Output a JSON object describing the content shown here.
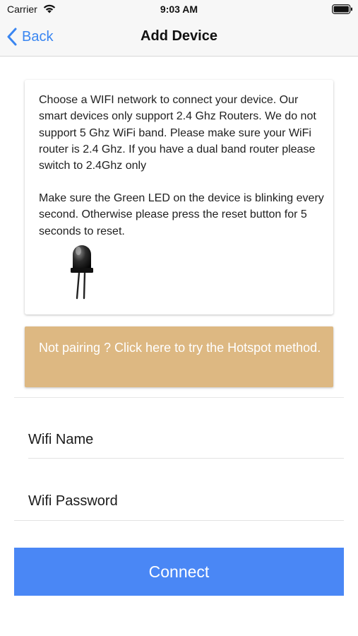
{
  "status_bar": {
    "carrier": "Carrier",
    "time": "9:03 AM",
    "wifi_icon": "wifi-icon",
    "battery_icon": "battery-icon"
  },
  "nav_bar": {
    "back_label": "Back",
    "back_icon": "chevron-left-icon",
    "title": "Add Device"
  },
  "info_card": {
    "paragraph_1": "Choose a WIFI network to connect your device. Our smart devices only support 2.4 Ghz Routers. We do not support 5 Ghz WiFi band. Please make sure your WiFi router is 2.4 Ghz. If you have a dual band router please switch to 2.4Ghz only",
    "paragraph_2": "Make sure the Green LED on the device is blinking every second. Otherwise please press the reset button for 5 seconds to reset.",
    "image_icon": "led-icon"
  },
  "hotspot_banner": {
    "text": "Not pairing ? Click here to try the Hotspot method."
  },
  "form": {
    "wifi_name_label": "Wifi Name",
    "wifi_password_label": "Wifi Password"
  },
  "connect_button": {
    "label": "Connect"
  },
  "colors": {
    "accent": "#3a86f1",
    "button": "#4a87f5",
    "banner": "#ddb882",
    "bar_background": "#f7f7f7"
  }
}
